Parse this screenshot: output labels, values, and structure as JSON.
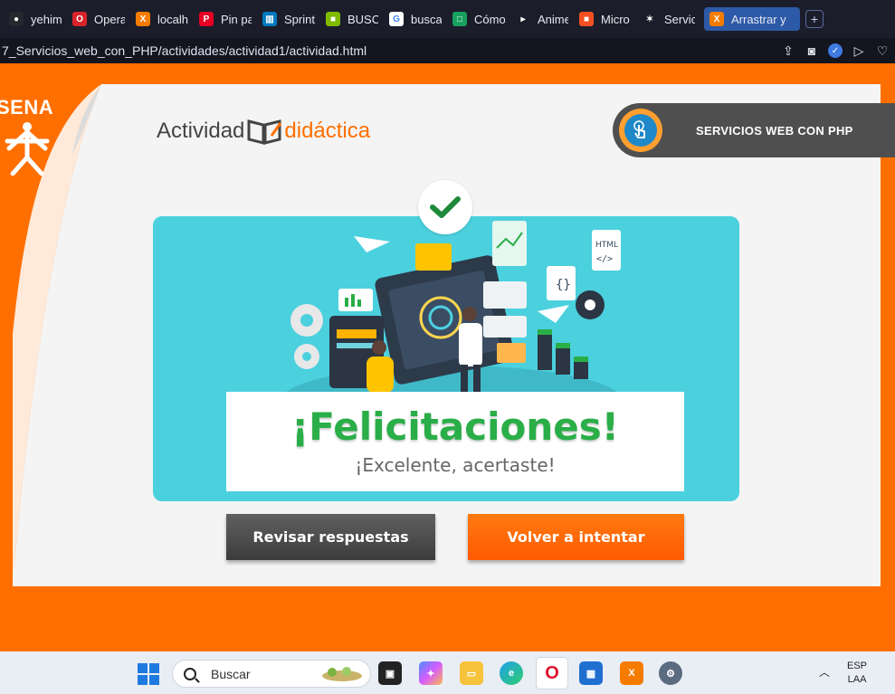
{
  "browser": {
    "tabs": [
      {
        "label": "yehim",
        "icon": "github-icon",
        "color": "#24292e",
        "glyph": "●"
      },
      {
        "label": "Opera",
        "icon": "opera-icon",
        "color": "#d8232a",
        "glyph": "O"
      },
      {
        "label": "localh",
        "icon": "xampp-icon",
        "color": "#f57c00",
        "glyph": "X"
      },
      {
        "label": "Pin pa",
        "icon": "pinterest-icon",
        "color": "#e60023",
        "glyph": "P"
      },
      {
        "label": "Sprint",
        "icon": "trello-icon",
        "color": "#0079bf",
        "glyph": "▥"
      },
      {
        "label": "BUSC",
        "icon": "microsoft-icon",
        "color": "#7fba00",
        "glyph": "■"
      },
      {
        "label": "busca",
        "icon": "google-icon",
        "color": "#ffffff",
        "glyph": "G"
      },
      {
        "label": "Cómo",
        "icon": "app-icon",
        "color": "#18a05e",
        "glyph": "□"
      },
      {
        "label": "Anime",
        "icon": "play-icon",
        "color": "#1b1d2b",
        "glyph": "▸"
      },
      {
        "label": "Micro",
        "icon": "microsoft-icon",
        "color": "#f25022",
        "glyph": "■"
      },
      {
        "label": "Servic",
        "icon": "sena-icon",
        "color": "#1b1d2b",
        "glyph": "✶"
      }
    ],
    "active_tab": {
      "label": "Arrastrar y",
      "icon": "xampp-icon"
    },
    "new_tab": "+",
    "url": "7_Servicios_web_con_PHP/actividades/actividad1/actividad.html"
  },
  "page": {
    "logo_text": "SENA",
    "brand_word1": "Actividad",
    "brand_word2": "didáctica",
    "course_label": "SERVICIOS WEB CON PHP",
    "result_title": "¡Felicitaciones!",
    "result_subtitle": "¡Excelente, acertaste!",
    "review_button": "Revisar respuestas",
    "retry_button": "Volver a intentar",
    "colors": {
      "accent": "#ff6f00",
      "success": "#2aae48",
      "card": "#4bd0de",
      "dark": "#4f4f4f"
    }
  },
  "taskbar": {
    "search_placeholder": "Buscar",
    "lang_line1": "ESP",
    "lang_line2": "LAA"
  }
}
